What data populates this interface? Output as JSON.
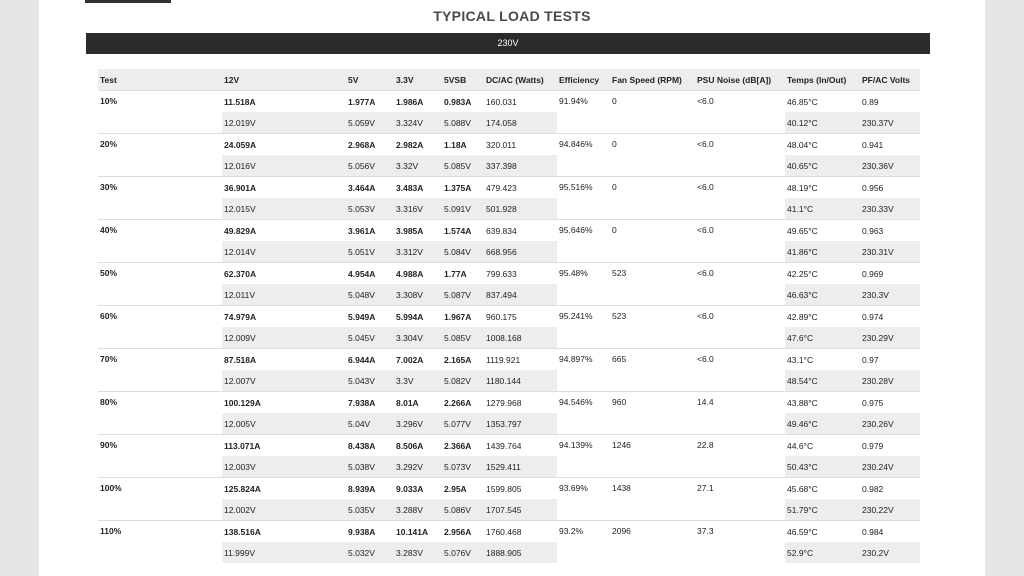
{
  "title": "TYPICAL LOAD TESTS",
  "voltage_label": "230V",
  "columns": [
    "Test",
    "12V",
    "5V",
    "3.3V",
    "5VSB",
    "DC/AC (Watts)",
    "Efficiency",
    "Fan Speed (RPM)",
    "PSU Noise (dB[A])",
    "Temps (In/Out)",
    "PF/AC Volts"
  ],
  "rows": [
    {
      "test": "10%",
      "a12": "11.518A",
      "a5": "1.977A",
      "a33": "1.986A",
      "a5sb": "0.983A",
      "dc": "160.031",
      "eff": "91.94%",
      "fan": "0",
      "noise": "<6.0",
      "temp_in": "46.85°C",
      "pf": "0.89",
      "v12": "12.019V",
      "v5": "5.059V",
      "v33": "3.324V",
      "v5sb": "5.088V",
      "ac": "174.058",
      "temp_out": "40.12°C",
      "acv": "230.37V"
    },
    {
      "test": "20%",
      "a12": "24.059A",
      "a5": "2.968A",
      "a33": "2.982A",
      "a5sb": "1.18A",
      "dc": "320.011",
      "eff": "94.846%",
      "fan": "0",
      "noise": "<6.0",
      "temp_in": "48.04°C",
      "pf": "0.941",
      "v12": "12.016V",
      "v5": "5.056V",
      "v33": "3.32V",
      "v5sb": "5.085V",
      "ac": "337.398",
      "temp_out": "40.65°C",
      "acv": "230.36V"
    },
    {
      "test": "30%",
      "a12": "36.901A",
      "a5": "3.464A",
      "a33": "3.483A",
      "a5sb": "1.375A",
      "dc": "479.423",
      "eff": "95.516%",
      "fan": "0",
      "noise": "<6.0",
      "temp_in": "48.19°C",
      "pf": "0.956",
      "v12": "12.015V",
      "v5": "5.053V",
      "v33": "3.316V",
      "v5sb": "5.091V",
      "ac": "501.928",
      "temp_out": "41.1°C",
      "acv": "230.33V"
    },
    {
      "test": "40%",
      "a12": "49.829A",
      "a5": "3.961A",
      "a33": "3.985A",
      "a5sb": "1.574A",
      "dc": "639.834",
      "eff": "95.646%",
      "fan": "0",
      "noise": "<6.0",
      "temp_in": "49.65°C",
      "pf": "0.963",
      "v12": "12.014V",
      "v5": "5.051V",
      "v33": "3.312V",
      "v5sb": "5.084V",
      "ac": "668.956",
      "temp_out": "41.86°C",
      "acv": "230.31V"
    },
    {
      "test": "50%",
      "a12": "62.370A",
      "a5": "4.954A",
      "a33": "4.988A",
      "a5sb": "1.77A",
      "dc": "799.633",
      "eff": "95.48%",
      "fan": "523",
      "noise": "<6.0",
      "temp_in": "42.25°C",
      "pf": "0.969",
      "v12": "12.011V",
      "v5": "5.048V",
      "v33": "3.308V",
      "v5sb": "5.087V",
      "ac": "837.494",
      "temp_out": "46.63°C",
      "acv": "230.3V"
    },
    {
      "test": "60%",
      "a12": "74.979A",
      "a5": "5.949A",
      "a33": "5.994A",
      "a5sb": "1.967A",
      "dc": "960.175",
      "eff": "95.241%",
      "fan": "523",
      "noise": "<6.0",
      "temp_in": "42.89°C",
      "pf": "0.974",
      "v12": "12.009V",
      "v5": "5.045V",
      "v33": "3.304V",
      "v5sb": "5.085V",
      "ac": "1008.168",
      "temp_out": "47.6°C",
      "acv": "230.29V"
    },
    {
      "test": "70%",
      "a12": "87.518A",
      "a5": "6.944A",
      "a33": "7.002A",
      "a5sb": "2.165A",
      "dc": "1119.921",
      "eff": "94.897%",
      "fan": "665",
      "noise": "<6.0",
      "temp_in": "43.1°C",
      "pf": "0.97",
      "v12": "12.007V",
      "v5": "5.043V",
      "v33": "3.3V",
      "v5sb": "5.082V",
      "ac": "1180.144",
      "temp_out": "48.54°C",
      "acv": "230.28V"
    },
    {
      "test": "80%",
      "a12": "100.129A",
      "a5": "7.938A",
      "a33": "8.01A",
      "a5sb": "2.266A",
      "dc": "1279.968",
      "eff": "94.546%",
      "fan": "960",
      "noise": "14.4",
      "temp_in": "43.88°C",
      "pf": "0.975",
      "v12": "12.005V",
      "v5": "5.04V",
      "v33": "3.296V",
      "v5sb": "5.077V",
      "ac": "1353.797",
      "temp_out": "49.46°C",
      "acv": "230.26V"
    },
    {
      "test": "90%",
      "a12": "113.071A",
      "a5": "8.438A",
      "a33": "8.506A",
      "a5sb": "2.366A",
      "dc": "1439.764",
      "eff": "94.139%",
      "fan": "1246",
      "noise": "22.8",
      "temp_in": "44.6°C",
      "pf": "0.979",
      "v12": "12.003V",
      "v5": "5.038V",
      "v33": "3.292V",
      "v5sb": "5.073V",
      "ac": "1529.411",
      "temp_out": "50.43°C",
      "acv": "230.24V"
    },
    {
      "test": "100%",
      "a12": "125.824A",
      "a5": "8.939A",
      "a33": "9.033A",
      "a5sb": "2.95A",
      "dc": "1599.805",
      "eff": "93.69%",
      "fan": "1438",
      "noise": "27.1",
      "temp_in": "45.68°C",
      "pf": "0.982",
      "v12": "12.002V",
      "v5": "5.035V",
      "v33": "3.288V",
      "v5sb": "5.086V",
      "ac": "1707.545",
      "temp_out": "51.79°C",
      "acv": "230.22V"
    },
    {
      "test": "110%",
      "a12": "138.516A",
      "a5": "9.938A",
      "a33": "10.141A",
      "a5sb": "2.956A",
      "dc": "1760.468",
      "eff": "93.2%",
      "fan": "2096",
      "noise": "37.3",
      "temp_in": "46.59°C",
      "pf": "0.984",
      "v12": "11.999V",
      "v5": "5.032V",
      "v33": "3.283V",
      "v5sb": "5.076V",
      "ac": "1888.905",
      "temp_out": "52.9°C",
      "acv": "230.2V"
    }
  ]
}
